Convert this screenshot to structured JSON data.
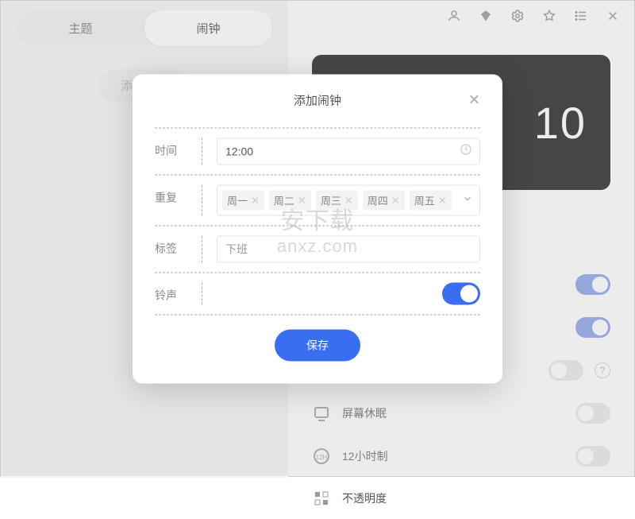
{
  "tabs": {
    "theme": "主题",
    "alarm": "闹钟"
  },
  "sidebar": {
    "add_alarm": "添加闹钟"
  },
  "clock": {
    "visible_digits": "10"
  },
  "settings": {
    "screen_sleep": "屏幕休眠",
    "hour12": "12小时制",
    "opacity": "不透明度"
  },
  "dialog": {
    "title": "添加闹钟",
    "fields": {
      "time": {
        "label": "时间",
        "value": "12:00"
      },
      "repeat": {
        "label": "重复",
        "chips": [
          "周一",
          "周二",
          "周三",
          "周四",
          "周五"
        ]
      },
      "tag": {
        "label": "标签",
        "value": "下班"
      },
      "ringtone": {
        "label": "铃声",
        "on": true
      }
    },
    "save": "保存"
  },
  "watermark": {
    "line1": "安下载",
    "line2": "anxz.com"
  }
}
